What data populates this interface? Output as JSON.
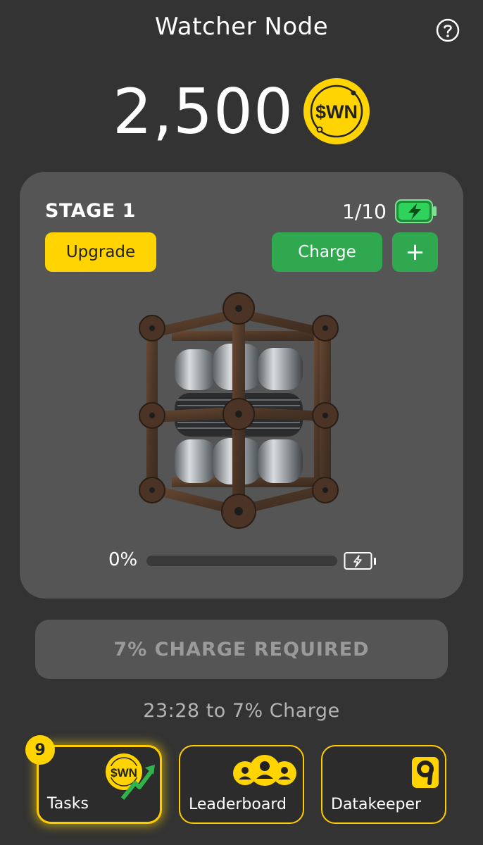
{
  "header": {
    "title": "Watcher Node",
    "help_icon": "question-circle-icon"
  },
  "balance": {
    "amount": "2,500",
    "currency_label": "$WN"
  },
  "stage_card": {
    "stage_label": "STAGE 1",
    "charges": "1/10",
    "battery_icon": "battery-charging-icon",
    "upgrade_label": "Upgrade",
    "charge_label": "Charge",
    "plus_label": "+",
    "node_image": "rusty-cube-node-image",
    "progress_value": 0,
    "progress_label": "0%",
    "progress_battery_icon": "battery-empty-icon"
  },
  "requirement": {
    "button_label": "7% CHARGE REQUIRED",
    "timer_text": "23:28 to 7% Charge"
  },
  "nav": [
    {
      "label": "Tasks",
      "badge": "9",
      "icon": "wn-coin-arrow-icon"
    },
    {
      "label": "Leaderboard",
      "icon": "users-group-icon"
    },
    {
      "label": "Datakeeper",
      "icon": "datakeeper-icon"
    }
  ],
  "colors": {
    "background": "#333333",
    "card": "#555555",
    "accent_yellow": "#ffd400",
    "accent_green": "#2fa84f"
  }
}
